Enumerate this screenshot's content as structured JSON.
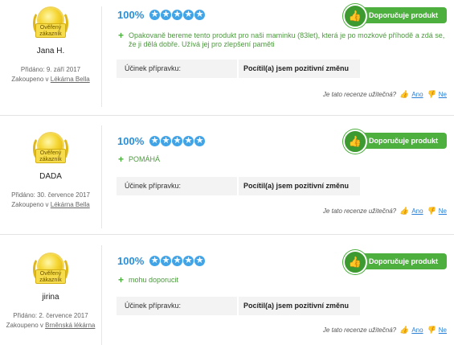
{
  "reviews": [
    {
      "badge_text": "Ověřený zákazník",
      "name": "Jana H.",
      "added": "Přidáno: 9. září 2017",
      "bought_prefix": "Zakoupeno v",
      "bought_shop": "Lékárna Bella",
      "percent": "100%",
      "rating_fraction": 1.0,
      "recommend_label": "Doporučuje produkt",
      "text": "Opakovaně bereme tento produkt pro naši maminku (83let), která je po mozkové příhodě a zdá se, že ji dělá dobře. Užívá jej pro zlepšení paměti",
      "effect_label": "Účinek přípravku:",
      "effect_value": "Pocítil(a) jsem pozitivní změnu",
      "useful_question": "Je tato recenze užitečná?",
      "yes": "Ano",
      "no": "Ne"
    },
    {
      "badge_text": "Ověřený zákazník",
      "name": "DADA",
      "added": "Přidáno: 30. července 2017",
      "bought_prefix": "Zakoupeno v",
      "bought_shop": "Lékárna Bella",
      "percent": "100%",
      "rating_fraction": 1.0,
      "recommend_label": "Doporučuje produkt",
      "text": "POMÁHÁ",
      "effect_label": "Účinek přípravku:",
      "effect_value": "Pocítil(a) jsem pozitivní změnu",
      "useful_question": "Je tato recenze užitečná?",
      "yes": "Ano",
      "no": "Ne"
    },
    {
      "badge_text": "Ověřený zákazník",
      "name": "jirina",
      "added": "Přidáno: 2. července 2017",
      "bought_prefix": "Zakoupeno v",
      "bought_shop": "Brněnská lékárna",
      "percent": "100%",
      "rating_fraction": 1.0,
      "recommend_label": "Doporučuje produkt",
      "text": "mohu doporucit",
      "effect_label": "Účinek přípravku:",
      "effect_value": "Pocítil(a) jsem pozitivní změnu",
      "useful_question": "Je tato recenze užitečná?",
      "yes": "Ano",
      "no": "Ne"
    }
  ],
  "colors": {
    "accent_blue": "#2a8fd6",
    "green": "#4caf3e",
    "red": "#d9372c"
  },
  "icons": {
    "badge": "verified-customer-badge-icon",
    "thumb": "thumbs-up-icon",
    "star": "star-icon"
  }
}
